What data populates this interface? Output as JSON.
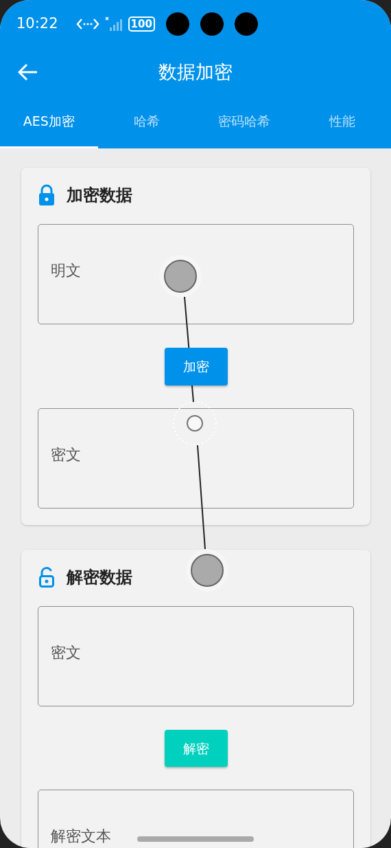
{
  "status_bar": {
    "time": "10:22",
    "battery": "100"
  },
  "app_bar": {
    "title": "数据加密"
  },
  "tabs": [
    {
      "label": "AES加密",
      "selected": true
    },
    {
      "label": "哈希",
      "selected": false
    },
    {
      "label": "密码哈希",
      "selected": false
    },
    {
      "label": "性能",
      "selected": false
    }
  ],
  "sections": [
    {
      "kind": "locked",
      "title": "加密数据",
      "input": {
        "placeholder": "明文"
      },
      "button": {
        "label": "加密",
        "color": "#0091ea"
      },
      "output": {
        "placeholder": "密文"
      }
    },
    {
      "kind": "unlocked",
      "title": "解密数据",
      "input": {
        "placeholder": "密文"
      },
      "button": {
        "label": "解密",
        "color": "#00d1be"
      },
      "output": {
        "placeholder": "解密文本"
      }
    }
  ]
}
